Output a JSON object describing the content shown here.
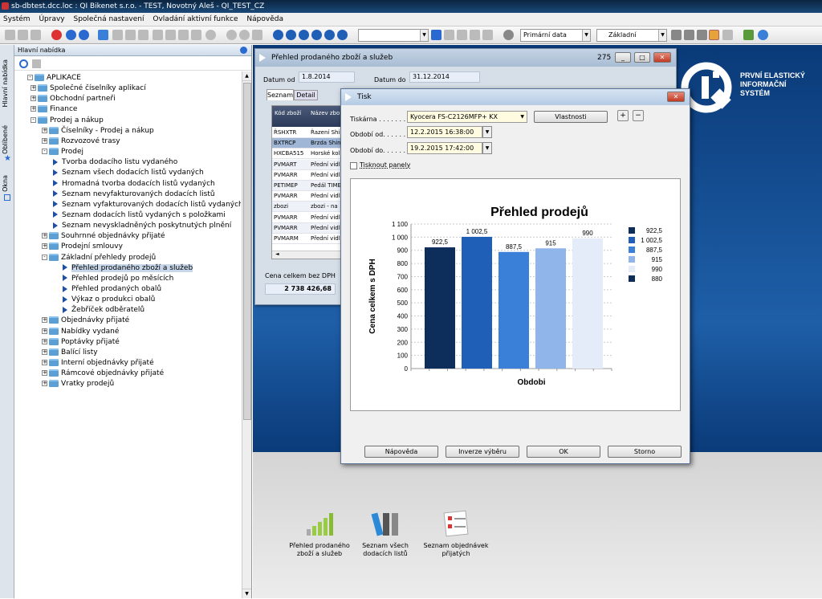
{
  "window": {
    "title": "sb-dbtest.dcc.loc : QI  Bikenet s.r.o. -  TEST, Novotný Aleš - QI_TEST_CZ"
  },
  "menu": [
    "Systém",
    "Úpravy",
    "Společná nastavení",
    "Ovladání aktivní funkce",
    "Nápověda"
  ],
  "toolbar": {
    "data_select": "Primární data",
    "view_select": "Základní"
  },
  "side_tabs": [
    "Hlavní nabídka",
    "Oblíbené",
    "Okna"
  ],
  "nav": {
    "title": "Hlavní nabídka",
    "tree": [
      {
        "label": "APLIKACE",
        "type": "folder",
        "level": 0,
        "state": "-"
      },
      {
        "label": "Společné číselníky aplikací",
        "type": "folder",
        "level": 1,
        "state": "+"
      },
      {
        "label": "Obchodní partneři",
        "type": "folder",
        "level": 1,
        "state": "+"
      },
      {
        "label": "Finance",
        "type": "folder",
        "level": 1,
        "state": "+"
      },
      {
        "label": "Prodej a nákup",
        "type": "folder",
        "level": 1,
        "state": "-"
      },
      {
        "label": "Číselníky - Prodej a nákup",
        "type": "folder",
        "level": 2,
        "state": "+"
      },
      {
        "label": "Rozvozové trasy",
        "type": "folder",
        "level": 2,
        "state": "+"
      },
      {
        "label": "Prodej",
        "type": "folder",
        "level": 2,
        "state": "-"
      },
      {
        "label": "Tvorba dodacího listu vydaného",
        "type": "item",
        "level": 3
      },
      {
        "label": "Seznam všech dodacích listů vydaných",
        "type": "item",
        "level": 3
      },
      {
        "label": "Hromadná tvorba dodacích listů vydaných",
        "type": "item",
        "level": 3
      },
      {
        "label": "Seznam nevyfakturovaných dodacích listů",
        "type": "item",
        "level": 3
      },
      {
        "label": "Seznam vyfakturovaných dodacích listů vydaných",
        "type": "item",
        "level": 3
      },
      {
        "label": "Seznam dodacích listů vydaných s položkami",
        "type": "item",
        "level": 3
      },
      {
        "label": "Seznam nevyskladněných poskytnutých plnění",
        "type": "item",
        "level": 3
      },
      {
        "label": "Souhrnné objednávky přijaté",
        "type": "folder",
        "level": 2,
        "state": "+"
      },
      {
        "label": "Prodejní smlouvy",
        "type": "folder",
        "level": 2,
        "state": "+"
      },
      {
        "label": "Základní přehledy prodejů",
        "type": "folder",
        "level": 2,
        "state": "-"
      },
      {
        "label": "Přehled prodaného zboží a služeb",
        "type": "item",
        "level": 4,
        "selected": true
      },
      {
        "label": "Přehled prodejů po měsících",
        "type": "item",
        "level": 4
      },
      {
        "label": "Přehled prodaných obalů",
        "type": "item",
        "level": 4
      },
      {
        "label": "Výkaz o produkci obalů",
        "type": "item",
        "level": 4
      },
      {
        "label": "Žebříček odběratelů",
        "type": "item",
        "level": 4
      },
      {
        "label": "Objednávky přijaté",
        "type": "folder",
        "level": 2,
        "state": "+"
      },
      {
        "label": "Nabídky vydané",
        "type": "folder",
        "level": 2,
        "state": "+"
      },
      {
        "label": "Poptávky přijaté",
        "type": "folder",
        "level": 2,
        "state": "+"
      },
      {
        "label": "Balící listy",
        "type": "folder",
        "level": 2,
        "state": "+"
      },
      {
        "label": "Interní objednávky přijaté",
        "type": "folder",
        "level": 2,
        "state": "+"
      },
      {
        "label": "Rámcové objednávky přijaté",
        "type": "folder",
        "level": 2,
        "state": "+"
      },
      {
        "label": "Vratky prodejů",
        "type": "folder",
        "level": 2,
        "state": "+"
      }
    ]
  },
  "logo": {
    "line1": "PRVNÍ ELASTICKÝ",
    "line2": "INFORMAČNÍ",
    "line3": "SYSTÉM"
  },
  "report_window": {
    "title": "Přehled prodaného zboží a služeb",
    "count": "275",
    "date_from_label": "Datum od",
    "date_from": "1.8.2014",
    "date_to_label": "Datum do",
    "date_to": "31.12.2014",
    "tabs": [
      "Seznam",
      "Detail"
    ],
    "columns": [
      "Kód zboží",
      "Název zbo"
    ],
    "rows": [
      [
        "ŘSHXTR",
        "Řazení Shi"
      ],
      [
        "BXTRCP",
        "Brzda Shin"
      ],
      [
        "HXCBA515",
        "Horské kol"
      ],
      [
        "PVMART",
        "Přední vidl"
      ],
      [
        "PVMARR",
        "Přední vidl"
      ],
      [
        "PETIMEP",
        "Pedál TIME"
      ],
      [
        "PVMARR",
        "Přední vidl"
      ],
      [
        "zbozi",
        "zbozi - na"
      ],
      [
        "PVMARR",
        "Přední vidl"
      ],
      [
        "PVMARR",
        "Přední vidl"
      ],
      [
        "PVMARM",
        "Přední vidl"
      ]
    ],
    "total_label": "Cena celkem bez DPH",
    "total_value": "2 738 426,68"
  },
  "print_dialog": {
    "title": "Tisk",
    "printer_label": "Tiskárna . . . . . . . .",
    "printer_value": "Kyocera FS-C2126MFP+ KX",
    "properties_button": "Vlastnosti",
    "period_from_label": "Období od. . . . . . .",
    "period_from": "12.2.2015 16:38:00",
    "period_to_label": "Období do. . . . . . .",
    "period_to": "19.2.2015 17:42:00",
    "print_panels_label": "Tisknout panely",
    "buttons": [
      "Nápověda",
      "Inverze výběru",
      "OK",
      "Storno"
    ]
  },
  "chart_data": {
    "type": "bar",
    "title": "Přehled prodejů",
    "xlabel": "Obdobi",
    "ylabel": "Cena celkem s DPH",
    "ylim": [
      0,
      1100
    ],
    "yticks": [
      "0",
      "100",
      "200",
      "300",
      "400",
      "500",
      "600",
      "700",
      "800",
      "900",
      "1 000",
      "1 100"
    ],
    "values": [
      922.5,
      1002.5,
      887.5,
      915,
      990
    ],
    "data_labels": [
      "922,5",
      "1 002,5",
      "887,5",
      "915",
      "990"
    ],
    "colors": [
      "#0d2d5a",
      "#1f5fb8",
      "#3a7fd8",
      "#8fb5ea",
      "#e3ecf8"
    ],
    "legend": {
      "placement": "right",
      "entries": [
        "922,5",
        "1 002,5",
        "887,5",
        "915",
        "990",
        "880"
      ],
      "colors": [
        "#0d2d5a",
        "#1f5fb8",
        "#3a7fd8",
        "#8fb5ea",
        "#e3ecf8",
        "#0d2d5a"
      ]
    },
    "grid": true
  },
  "dock": [
    {
      "label": "Přehled prodaného zboží a služeb",
      "icon": "chart-icon"
    },
    {
      "label": "Seznam všech dodacích listů",
      "icon": "binders-icon"
    },
    {
      "label": "Seznam objednávek přijatých",
      "icon": "checklist-icon"
    }
  ]
}
